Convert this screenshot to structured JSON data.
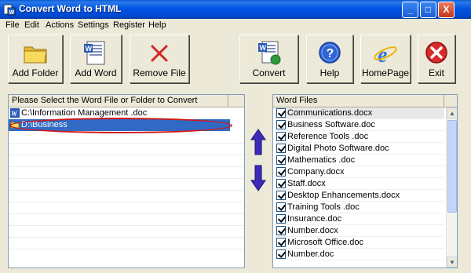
{
  "window": {
    "title": "Convert Word to HTML",
    "controls": {
      "minimize": "_",
      "maximize": "□",
      "close": "X"
    }
  },
  "menu": [
    "File",
    "Edit",
    "Actions",
    "Settings",
    "Register",
    "Help"
  ],
  "toolbar": {
    "add_folder": {
      "label": "Add Folder",
      "icon": "folder-icon"
    },
    "add_word": {
      "label": "Add Word",
      "icon": "word-document-icon"
    },
    "remove_file": {
      "label": "Remove File",
      "icon": "red-x-icon"
    },
    "convert": {
      "label": "Convert",
      "icon": "word-to-html-icon"
    },
    "help": {
      "label": "Help",
      "icon": "help-question-icon"
    },
    "homepage": {
      "label": "HomePage",
      "icon": "internet-explorer-icon"
    },
    "exit": {
      "label": "Exit",
      "icon": "exit-close-icon"
    }
  },
  "left_panel": {
    "header": "Please Select the Word File or Folder to Convert",
    "items": [
      {
        "text": "C:\\Information Management .doc",
        "icon": "word-file-icon",
        "selected": false
      },
      {
        "text": "D:\\Business",
        "icon": "folder-icon",
        "selected": true
      }
    ]
  },
  "arrows": {
    "up": "move-up-arrow-icon",
    "down": "move-down-arrow-icon"
  },
  "right_panel": {
    "header": "Word Files",
    "files": [
      "Communications.docx",
      "Business Software.doc",
      "Reference Tools .doc",
      "Digital Photo Software.doc",
      "Mathematics .doc",
      "Company.docx",
      "Staff.docx",
      "Desktop Enhancements.docx",
      "Training Tools .doc",
      "Insurance.doc",
      "Number.docx",
      "Microsoft Office.doc",
      "Number.doc"
    ]
  },
  "colors": {
    "titlebar": "#0054e3",
    "selection": "#316ac5",
    "highlight_ellipse": "#d01818",
    "arrow": "#3b2bbd"
  }
}
